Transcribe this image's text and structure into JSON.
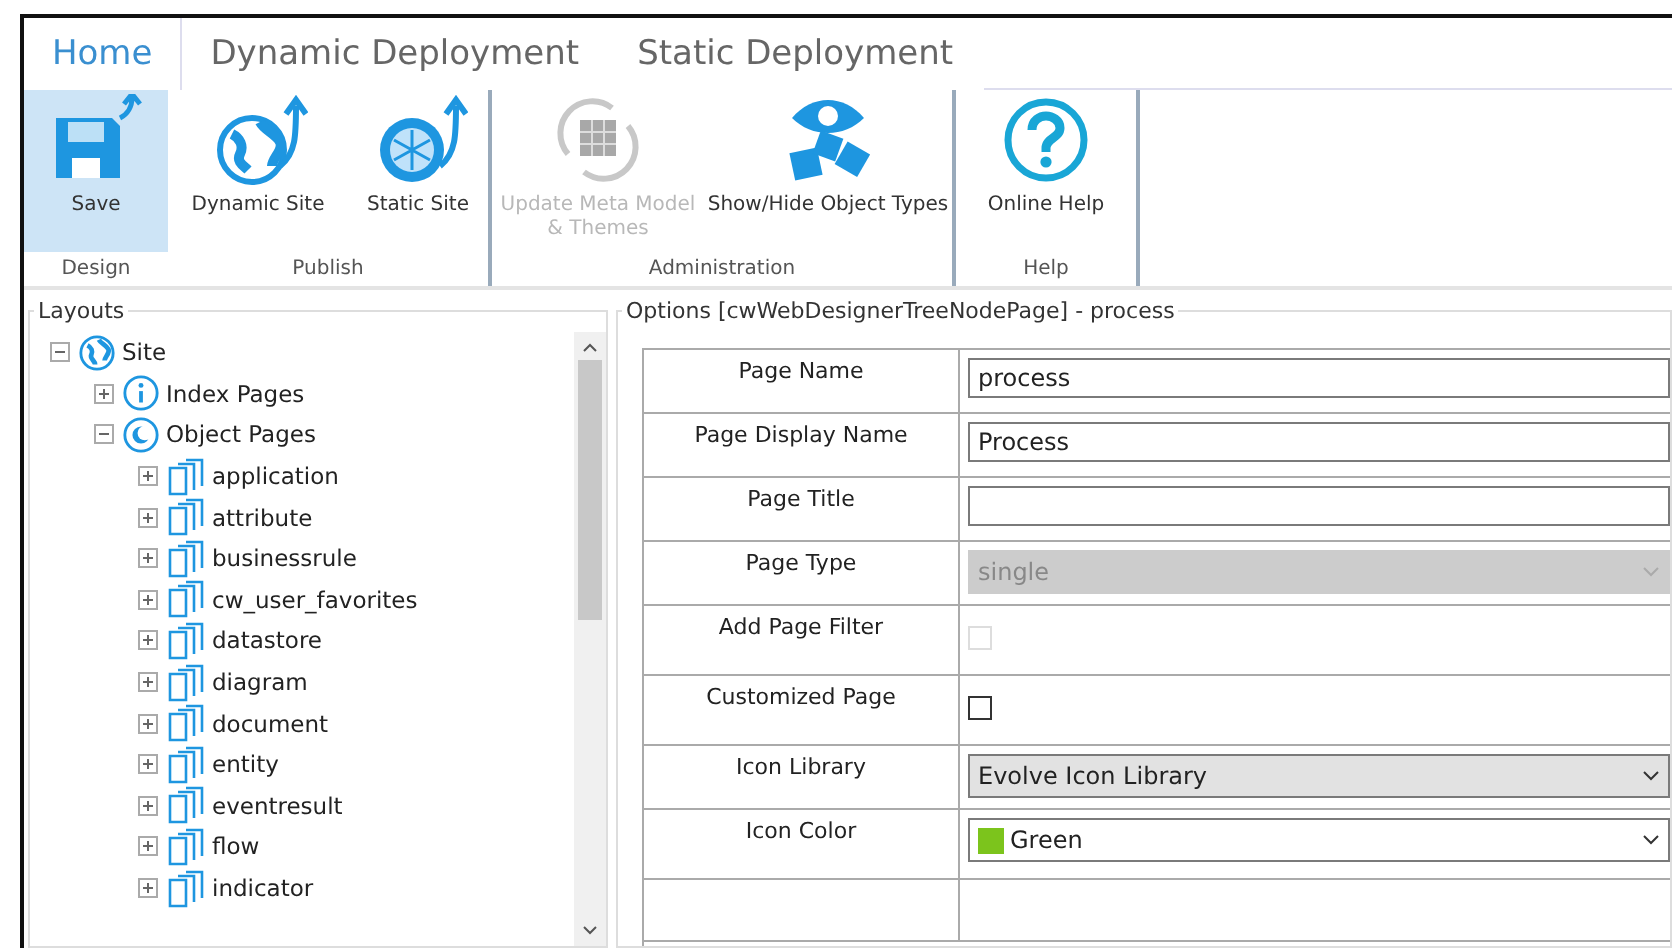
{
  "tabs": [
    {
      "label": "Home",
      "selected": true
    },
    {
      "label": "Dynamic Deployment",
      "selected": false
    },
    {
      "label": "Static Deployment",
      "selected": false
    }
  ],
  "ribbon_groups": [
    {
      "label": "Design",
      "buttons": [
        {
          "kind": "save",
          "label": "Save",
          "selected": true,
          "disabled": false
        }
      ]
    },
    {
      "label": "Publish",
      "buttons": [
        {
          "kind": "dynamic",
          "label": "Dynamic Site",
          "selected": false,
          "disabled": false
        },
        {
          "kind": "static",
          "label": "Static Site",
          "selected": false,
          "disabled": false
        }
      ]
    },
    {
      "label": "Administration",
      "buttons": [
        {
          "kind": "update",
          "label": "Update Meta Model & Themes",
          "selected": false,
          "disabled": true
        },
        {
          "kind": "showhide",
          "label": "Show/Hide Object Types",
          "selected": false,
          "disabled": false
        }
      ]
    },
    {
      "label": "Help",
      "buttons": [
        {
          "kind": "help",
          "label": "Online Help",
          "selected": false,
          "disabled": false
        }
      ]
    }
  ],
  "layouts": {
    "title": "Layouts",
    "tree": [
      {
        "kind": "site",
        "label": "Site",
        "expanded": true,
        "children": [
          {
            "kind": "index",
            "label": "Index Pages",
            "expanded": false
          },
          {
            "kind": "object",
            "label": "Object Pages",
            "expanded": true,
            "children": [
              {
                "kind": "page",
                "label": "application",
                "expanded": false
              },
              {
                "kind": "page",
                "label": "attribute",
                "expanded": false
              },
              {
                "kind": "page",
                "label": "businessrule",
                "expanded": false
              },
              {
                "kind": "page",
                "label": "cw_user_favorites",
                "expanded": false
              },
              {
                "kind": "page",
                "label": "datastore",
                "expanded": false
              },
              {
                "kind": "page",
                "label": "diagram",
                "expanded": false
              },
              {
                "kind": "page",
                "label": "document",
                "expanded": false
              },
              {
                "kind": "page",
                "label": "entity",
                "expanded": false
              },
              {
                "kind": "page",
                "label": "eventresult",
                "expanded": false
              },
              {
                "kind": "page",
                "label": "flow",
                "expanded": false
              },
              {
                "kind": "page",
                "label": "indicator",
                "expanded": false
              }
            ]
          }
        ]
      }
    ]
  },
  "options": {
    "title": "Options [cwWebDesignerTreeNodePage] - process",
    "rows": [
      {
        "kind": "text",
        "label": "Page Name",
        "value": "process"
      },
      {
        "kind": "text",
        "label": "Page Display Name",
        "value": "Process"
      },
      {
        "kind": "text",
        "label": "Page Title"
      },
      {
        "kind": "select",
        "label": "Page Type",
        "value": "single",
        "disabled": true
      },
      {
        "kind": "checkbox",
        "label": "Add Page Filter",
        "checked": false,
        "disabled": true
      },
      {
        "kind": "checkbox",
        "label": "Customized Page",
        "checked": false,
        "disabled": false
      },
      {
        "kind": "select",
        "label": "Icon Library",
        "value": "Evolve Icon Library",
        "disabled": false
      },
      {
        "kind": "swatch",
        "label": "Icon Color",
        "value": "Green",
        "color": "#7cc41c"
      }
    ]
  }
}
